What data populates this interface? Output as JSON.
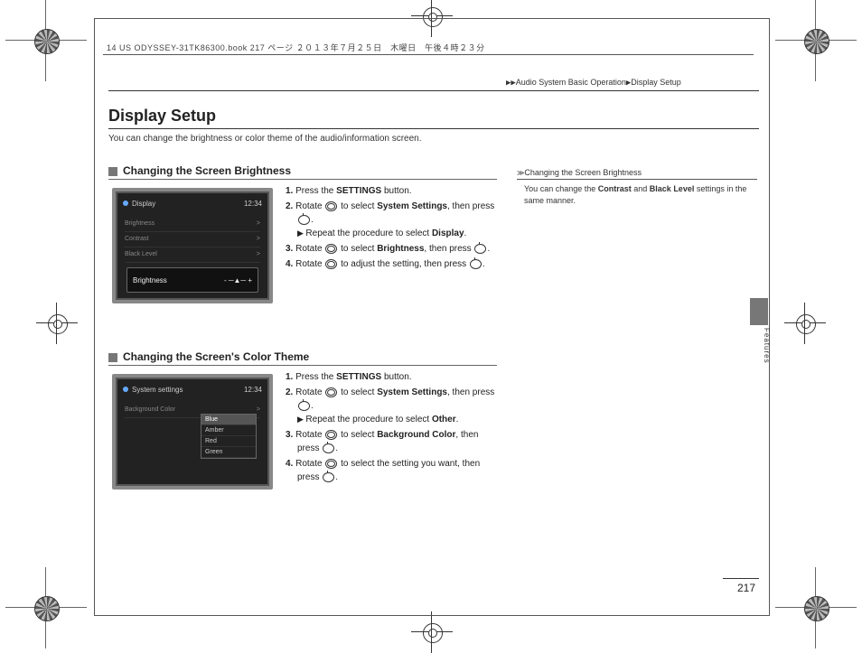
{
  "doc_header": "14 US ODYSSEY-31TK86300.book  217 ページ  ２０１３年７月２５日　木曜日　午後４時２３分",
  "breadcrumb": {
    "a": "Audio System Basic Operation",
    "b": "Display Setup"
  },
  "title": "Display Setup",
  "intro": "You can change the brightness or color theme of the audio/information screen.",
  "section1": {
    "heading": "Changing the Screen Brightness",
    "shot": {
      "title_left": "Display",
      "time": "12:34",
      "rows": [
        "Brightness",
        "Contrast",
        "Black Level"
      ],
      "popup_label": "Brightness"
    },
    "steps": {
      "s1a": "Press the ",
      "s1b": "SETTINGS",
      "s1c": " button.",
      "s2a": "Rotate ",
      "s2b": " to select ",
      "s2c": "System Settings",
      "s2d": ", then press ",
      "s2e": ".",
      "s2f": "Repeat the procedure to select ",
      "s2g": "Display",
      "s3a": "Rotate ",
      "s3b": " to select ",
      "s3c": "Brightness",
      "s3d": ", then press ",
      "s4a": "Rotate ",
      "s4b": " to adjust the setting, then press "
    }
  },
  "section2": {
    "heading": "Changing the Screen's Color Theme",
    "shot": {
      "title_left": "System settings",
      "time": "12:34",
      "left_label": "Background Color",
      "options": [
        "Blue",
        "Amber",
        "Red",
        "Green"
      ]
    },
    "steps": {
      "s1a": "Press the ",
      "s1b": "SETTINGS",
      "s1c": " button.",
      "s2a": "Rotate ",
      "s2b": " to select ",
      "s2c": "System Settings",
      "s2d": ", then press ",
      "s2f": "Repeat the procedure to select ",
      "s2g": "Other",
      "s3a": "Rotate ",
      "s3b": " to select ",
      "s3c": "Background Color",
      "s3d": ", then press ",
      "s4a": "Rotate ",
      "s4b": " to select the setting you want, then press "
    }
  },
  "sidebar": {
    "head": "Changing the Screen Brightness",
    "body_a": "You can change the ",
    "body_b": "Contrast",
    "body_c": " and ",
    "body_d": "Black Level",
    "body_e": " settings in the same manner."
  },
  "side_label": "Features",
  "page_num": "217"
}
